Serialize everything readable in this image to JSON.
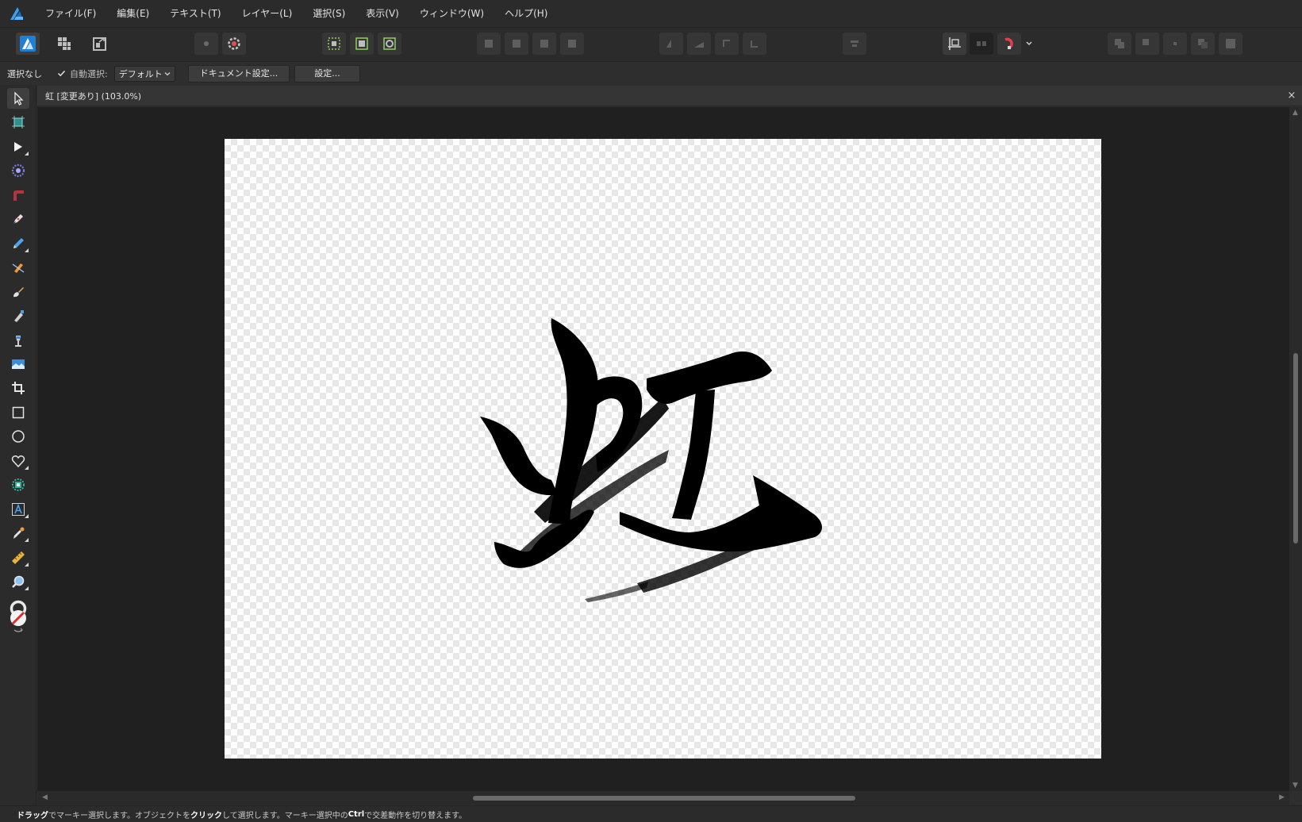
{
  "app": {
    "logo_icon": "affinity-designer-logo-icon",
    "accent": "#1e88e5"
  },
  "menu": [
    "ファイル(F)",
    "編集(E)",
    "テキスト(T)",
    "レイヤー(L)",
    "選択(S)",
    "表示(V)",
    "ウィンドウ(W)",
    "ヘルプ(H)"
  ],
  "context_bar": {
    "selection_status": "選択なし",
    "auto_select_checked": true,
    "auto_select_label": "自動選択:",
    "auto_select_value": "デフォルト",
    "document_setup_button": "ドキュメント設定...",
    "settings_button": "設定..."
  },
  "document": {
    "tab_title": "虹 [変更あり] (103.0%)",
    "close_symbol": "×",
    "artwork_character": "虹"
  },
  "status": {
    "parts": [
      {
        "text": "ドラッグ",
        "bold": true
      },
      {
        "text": "でマーキー選択します。オブジェクトを",
        "bold": false
      },
      {
        "text": "クリック",
        "bold": true
      },
      {
        "text": "して選択します。マーキー選択中の",
        "bold": false
      },
      {
        "text": "Ctrl",
        "bold": true
      },
      {
        "text": "で交差動作を切り替えます。",
        "bold": false
      }
    ]
  },
  "tools": [
    "move-tool-icon",
    "artboard-tool-icon",
    "node-tool-icon",
    "point-transform-tool-icon",
    "corner-tool-icon",
    "pen-tool-icon",
    "pencil-tool-icon",
    "vector-brush-tool-icon",
    "paint-brush-icon",
    "pixel-brush-icon",
    "fill-tool-icon",
    "place-image-tool-icon",
    "crop-tool-icon",
    "rectangle-tool-icon",
    "ellipse-tool-icon",
    "heart-shape-tool-icon",
    "shape-builder-tool-icon",
    "artistic-text-tool-icon",
    "color-picker-tool-icon",
    "measure-tool-icon",
    "zoom-tool-icon"
  ]
}
